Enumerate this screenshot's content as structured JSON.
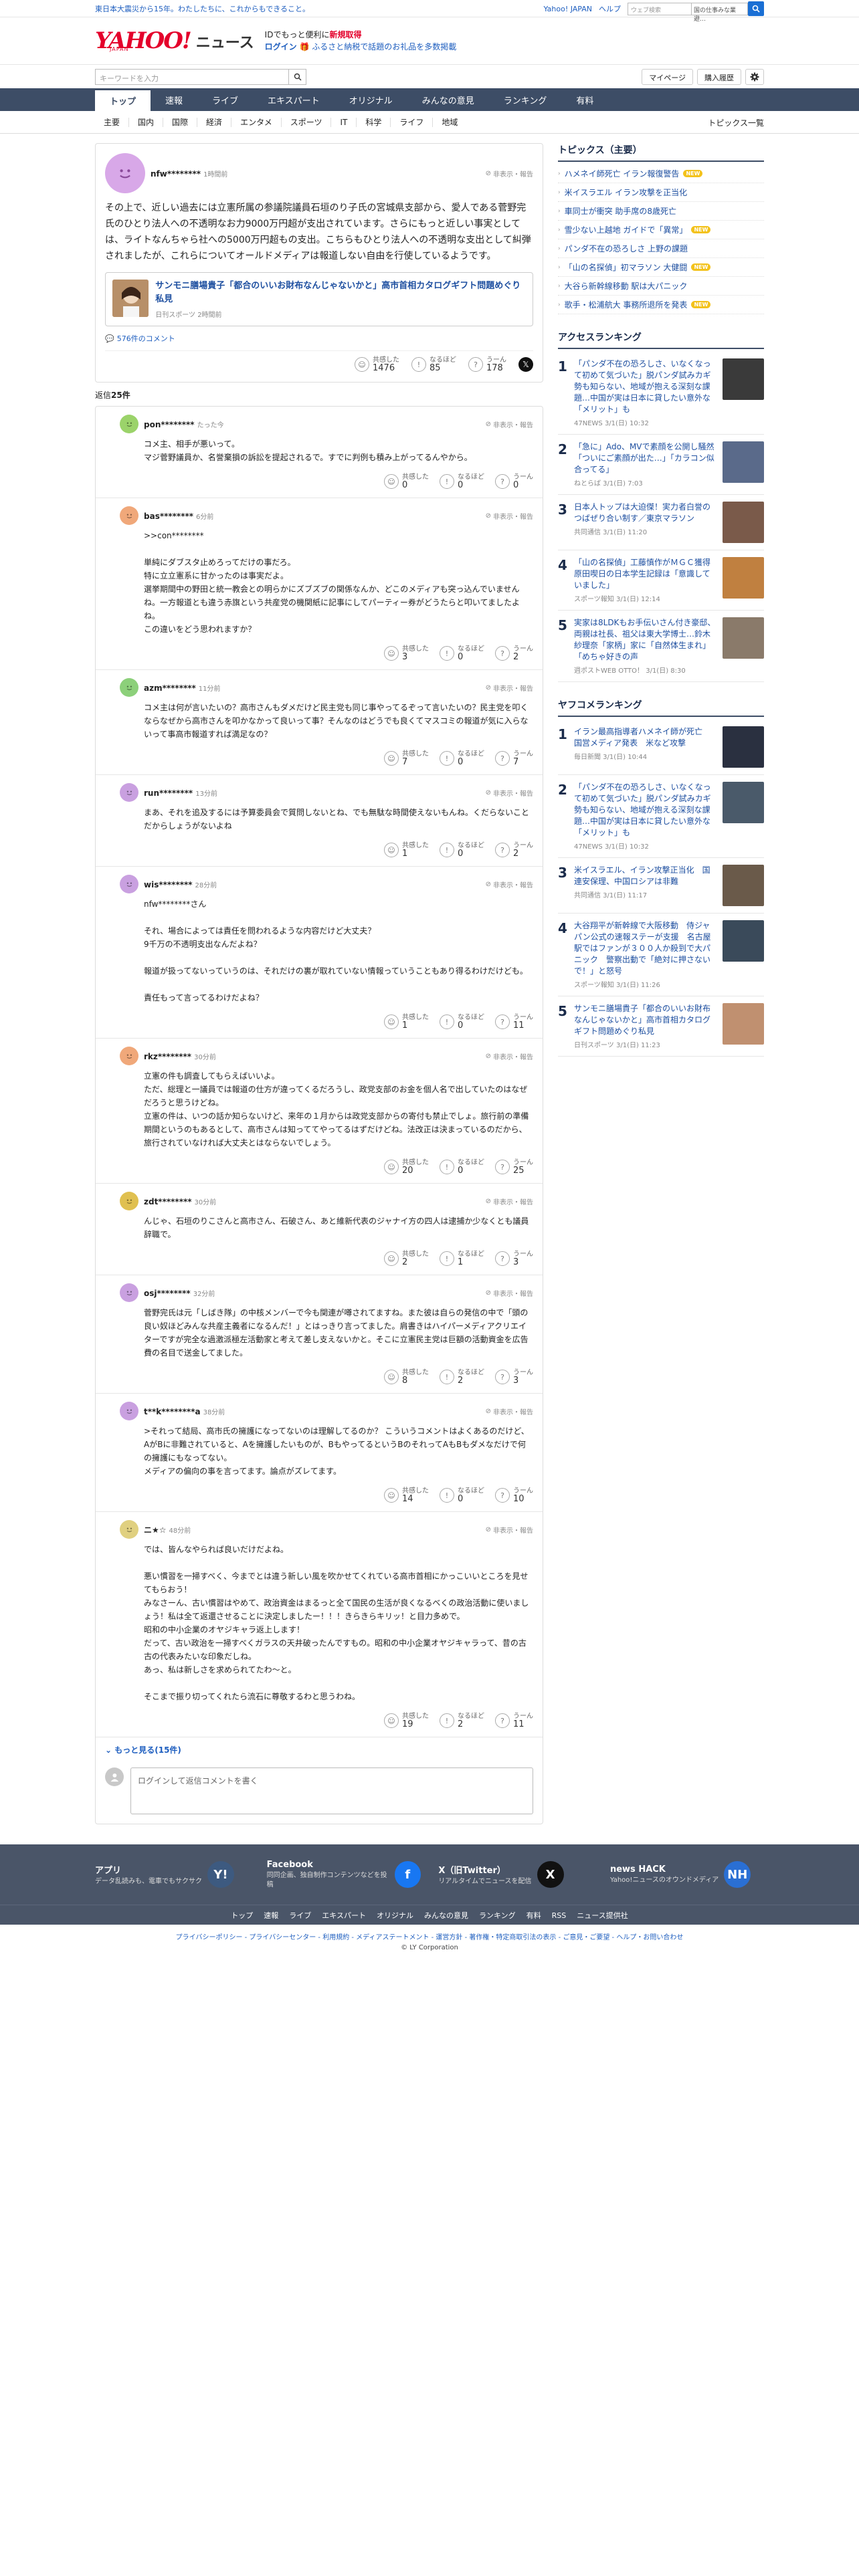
{
  "topbar": {
    "notice": "東日本大震災から15年。わたしたちに、これからもできること。",
    "links": [
      "Yahoo! JAPAN",
      "ヘルプ"
    ],
    "search_placeholder": "ウェブ検索",
    "search_mid": "国の仕事みな業 避…"
  },
  "header": {
    "logo_text": "YAHOO!",
    "logo_sub": "JAPAN",
    "logo_news": "ニュース",
    "promo_line1_pre": "IDでもっと便利に",
    "promo_line1_red": "新規取得",
    "promo_login": "ログイン",
    "promo_line2": "ふるさと納税で話題のお礼品を多数掲載"
  },
  "searchrow": {
    "placeholder": "キーワードを入力",
    "mypage": "マイページ",
    "purchase": "購入履歴"
  },
  "nav": [
    "トップ",
    "速報",
    "ライブ",
    "エキスパート",
    "オリジナル",
    "みんなの意見",
    "ランキング",
    "有料"
  ],
  "subnav": {
    "items": [
      "主要",
      "国内",
      "国際",
      "経済",
      "エンタメ",
      "スポーツ",
      "IT",
      "科学",
      "ライフ",
      "地域"
    ],
    "all": "トピックス一覧"
  },
  "post": {
    "user": "nfw********",
    "time": "1時間前",
    "report": "非表示・報告",
    "text": "その上で、近しい過去には立憲所属の参議院議員石垣のり子氏の宮城県支部から、愛人である菅野完氏のひとり法人への不透明なお力9000万円超が支出されています。さらにもっと近しい事実としては、ライトなんちゃら社への5000万円超もの支出。こちらもひとり法人への不透明な支出として糾弾されましたが、これらについてオールドメディアは報道しない自由を行使しているようです。",
    "article_title": "サンモニ膳場貴子「都合のいいお財布なんじゃないかと」高市首相カタログギフト問題めぐり私見",
    "article_meta": "日刊スポーツ 2時間前",
    "comment_count": "576件のコメント",
    "reactions": {
      "k": "共感した",
      "kv": "1476",
      "n": "なるほど",
      "nv": "85",
      "u": "うーん",
      "uv": "178"
    },
    "reply_count_label": "返信",
    "reply_count": "25件"
  },
  "replies": [
    {
      "user": "pon********",
      "time": "たった今",
      "color": "#9bd36a",
      "text": "コメ主、相手が悪いって。\nマジ菅野議員か、名誉棄損の訴訟を提起されるで。すでに判例も積み上がってるんやから。",
      "k": "0",
      "n": "0",
      "u": "0"
    },
    {
      "user": "bas********",
      "time": "6分前",
      "color": "#f0a87a",
      "text": ">>con********\n\n単純にダブスタ止めろってだけの事だろ。\n特に立立憲系に甘かったのは事実だよ。\n選挙期間中の野田と統一教会との明らかにズブズブの関係なんか、どこのメディアも突っ込んでいませんね。一方報道とも違う赤旗という共産党の機関紙に記事にしてパーティー券がどうたらと叩いてましたよね。\nこの違いをどう思われますか？",
      "k": "3",
      "n": "0",
      "u": "2"
    },
    {
      "user": "azm********",
      "time": "11分前",
      "color": "#8cd07a",
      "text": "コメ主は何が言いたいの？高市さんもダメだけど民主党も同じ事やってるぞって言いたいの？民主党を叩くならなぜから高市さんを叩かなかって良いって事？そんなのはどうでも良くてマスコミの報道が気に入らないって事高市報道すれば満足なの？",
      "k": "7",
      "n": "0",
      "u": "7"
    },
    {
      "user": "run********",
      "time": "13分前",
      "color": "#c9a0e0",
      "text": "まあ、それを追及するには予算委員会で質問しないとね、でも無駄な時間使えないもんね。くだらないことだからしょうがないよね",
      "k": "1",
      "n": "0",
      "u": "2"
    },
    {
      "user": "wis********",
      "time": "28分前",
      "color": "#c9a0e0",
      "text": "nfw********さん\n\nそれ、場合によっては責任を問われるような内容だけど大丈夫？\n9千万の不透明支出なんだよね？\n\n報道が扱ってないっていうのは、それだけの裏が取れていない情報っていうこともあり得るわけだけども。\n\n責任もって言ってるわけだよね？",
      "k": "1",
      "n": "0",
      "u": "11"
    },
    {
      "user": "rkz********",
      "time": "30分前",
      "color": "#f0a87a",
      "text": "立憲の件も調査してもらえばいいよ。\nただ、総理と一議員では報道の仕方が違ってくるだろうし、政党支部のお金を個人名で出していたのはなぜだろうと思うけどね。\n立憲の件は、いつの話か知らないけど、来年の１月からは政党支部からの寄付も禁止でしょ。旅行前の準備期間というのもあるとして、高市さんは知っててやってるはずだけどね。法改正は決まっているのだから、旅行されていなければ大丈夫とはならないでしょう。",
      "k": "20",
      "n": "0",
      "u": "25"
    },
    {
      "user": "zdt********",
      "time": "30分前",
      "color": "#e0c050",
      "text": "んじゃ、石垣のりこさんと高市さん、石破さん、あと維新代表のジャナイ方の四人は逮捕か少なくとも議員辞職で。",
      "k": "2",
      "n": "1",
      "u": "3"
    },
    {
      "user": "osj********",
      "time": "32分前",
      "color": "#c9a0e0",
      "text": "菅野完氏は元「しばき隊」の中核メンバーで今も関連が噂されてますね。また彼は自らの発信の中で「頭の良い奴ほどみんな共産主義者になるんだ！」とはっきり言ってました。肩書きはハイパーメディアクリエイターですが完全な過激派極左活動家と考えて差し支えないかと。そこに立憲民主党は巨額の活動資金を広告費の名目で送金してました。",
      "k": "8",
      "n": "2",
      "u": "3"
    },
    {
      "user": "t**k********a",
      "time": "38分前",
      "color": "#c9a0e0",
      "text": ">それって結局、高市氏の擁護になってないのは理解してるのか？ こういうコメントはよくあるのだけど、AがBに非難されていると、Aを擁護したいものが、BもやってるというBのそれってAもBもダメなだけで何の擁護にもなってない。\nメディアの偏向の事を言ってます。論点がズレてます。",
      "k": "14",
      "n": "0",
      "u": "10"
    },
    {
      "user": "ニ★☆",
      "time": "48分前",
      "color": "#e0d080",
      "text": "では、皆んなやられば良いだけだよね。\n\n悪い慣習を一掃すべく、今までとは違う新しい風を吹かせてくれている高市首相にかっこいいところを見せてもらおう！\nみなさーん、古い慣習はやめて、政治資金はまるっと全て国民の生活が良くなるべくの政治活動に使いましょう！私は全て返還させることに決定しましたー！！！きらきらキリッ！と目力多めで。\n昭和の中小企業のオヤジキャラ返上します！\nだって、古い政治を一掃すべくガラスの天井破ったんですもの。昭和の中小企業オヤジキャラって、昔の古古の代表みたいな印象だしね。\nあっ、私は新しさを求められてたわ〜と。\n\nそこまで振り切ってくれたら流石に尊敬するわと思うわね。",
      "k": "19",
      "n": "2",
      "u": "11"
    }
  ],
  "reply_ui": {
    "more": "もっと見る(15件)",
    "placeholder": "ログインして返信コメントを書く"
  },
  "sidebar": {
    "topics_title": "トピックス（主要）",
    "topics": [
      {
        "t": "ハメネイ師死亡 イラン報復警告",
        "new": true
      },
      {
        "t": "米イスラエル イラン攻撃を正当化",
        "new": false
      },
      {
        "t": "車同士が衝突 助手席の8歳死亡",
        "new": false
      },
      {
        "t": "雪少ない上越地 ガイドで「異常」",
        "new": true
      },
      {
        "t": "パンダ不在の恐ろしさ 上野の課題",
        "new": false
      },
      {
        "t": "「山の名探偵」初マラソン 大健闘",
        "new": true
      },
      {
        "t": "大谷ら新幹線移動 駅は大パニック",
        "new": false
      },
      {
        "t": "歌手・松浦航大 事務所退所を発表",
        "new": true
      }
    ],
    "new_label": "NEW",
    "access_title": "アクセスランキング",
    "access": [
      {
        "t": "「パンダ不在の恐ろしさ、いなくなって初めて気づいた」脱パンダ試みカギ勢も知らない、地域が抱える深刻な課題…中国が実は日本に貸したい意外な「メリット」も",
        "s": "47NEWS 3/1(日) 10:32",
        "c": "#3a3a3a"
      },
      {
        "t": "「急に」Ado、MVで素顔を公開し騒然「ついにご素顔が出た…」「カラコン似合ってる」",
        "s": "ねとらば 3/1(日) 7:03",
        "c": "#5a6a8a"
      },
      {
        "t": "日本人トップは大迫傑！実力者白誉のつばぜり合い制す／東京マラソン",
        "s": "共同通信 3/1(日) 11:20",
        "c": "#7a5a4a"
      },
      {
        "t": "「山の名探偵」工藤慎作がＭＧＣ獲得 原田喫日の日本学生記録は「意識していました」",
        "s": "スポーツ報知 3/1(日) 12:14",
        "c": "#c08040"
      },
      {
        "t": "実家は8LDKもお手伝いさん付き豪邸、両親は社長、祖父は東大学博士…鈴木紗理奈「家柄」家に「自然体生まれ」「めちゃ好きの声",
        "s": "週ポストWEB OTTO！ 3/1(日) 8:30",
        "c": "#8a7a6a"
      }
    ],
    "yahoo_title": "ヤフコメランキング",
    "yahoo": [
      {
        "t": "イラン最高指導者ハメネイ師が死亡　国営メディア発表　米など攻撃",
        "s": "毎日新聞 3/1(日) 10:44",
        "c": "#2a3040"
      },
      {
        "t": "「パンダ不在の恐ろしさ、いなくなって初めて気づいた」脱パンダ試みカギ勢も知らない、地域が抱える深刻な課題…中国が実は日本に貸したい意外な「メリット」も",
        "s": "47NEWS 3/1(日) 10:32",
        "c": "#4a5a6a"
      },
      {
        "t": "米イスラエル、イラン攻撃正当化　国連安保理、中国ロシアは非難",
        "s": "共同通信 3/1(日) 11:17",
        "c": "#6a5a4a"
      },
      {
        "t": "大谷翔平が新幹線で大阪移動　侍ジャパン公式の速報ステーが支援　名古屋駅ではファンが３００人か殺到で大パニック　警察出動で「絶対に押さないで！」と怒号",
        "s": "スポーツ報知 3/1(日) 11:26",
        "c": "#3a4a5a"
      },
      {
        "t": "サンモニ膳場貴子「都合のいいお財布なんじゃないかと」高市首相カタログギフト問題めぐり私見",
        "s": "日刊スポーツ 3/1(日) 11:23",
        "c": "#c09070"
      }
    ]
  },
  "footer": {
    "boxes": [
      {
        "t": "アプリ",
        "d": "データ乱読みも、電車でもサクサク",
        "ic": "Y!",
        "c": "#3d5a80"
      },
      {
        "t": "Facebook",
        "d": "同同企画、独自制作コンテンツなどを投稿",
        "ic": "f",
        "c": "#1877f2"
      },
      {
        "t": "X（旧Twitter）",
        "d": "リアルタイムでニュースを配信",
        "ic": "X",
        "c": "#111111"
      },
      {
        "t": "news HACK",
        "d": "Yahoo!ニュースのオウンドメディア",
        "ic": "NH",
        "c": "#2a6fd4"
      }
    ],
    "links": [
      "トップ",
      "速報",
      "ライブ",
      "エキスパート",
      "オリジナル",
      "みんなの意見",
      "ランキング",
      "有料",
      "RSS",
      "ニュース提供社"
    ],
    "legal": "プライバシーポリシー - プライバシーセンター - 利用規約 - メディアステートメント - 運営方針 - 著作権・特定商取引法の表示 - ご意見・ご要望 - ヘルプ・お問い合わせ",
    "copy": "© LY Corporation"
  }
}
